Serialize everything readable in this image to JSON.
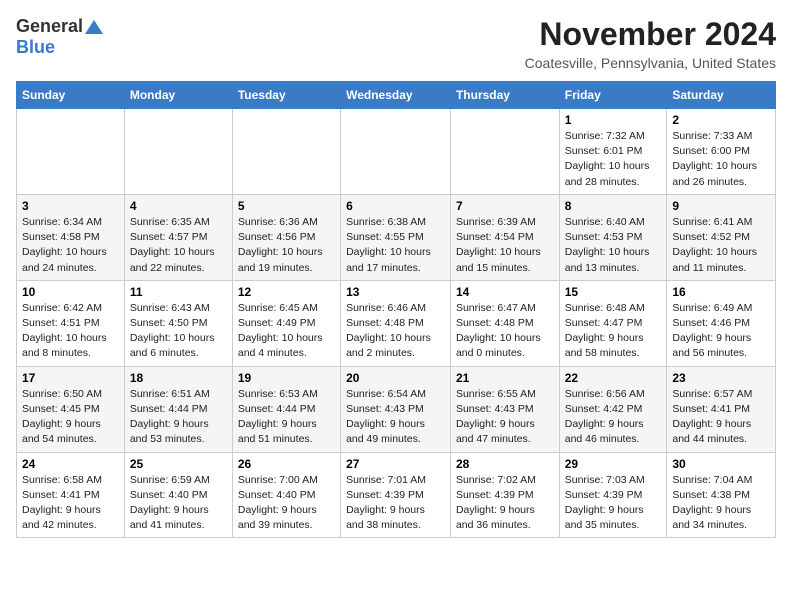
{
  "header": {
    "logo_general": "General",
    "logo_blue": "Blue",
    "month": "November 2024",
    "location": "Coatesville, Pennsylvania, United States"
  },
  "weekdays": [
    "Sunday",
    "Monday",
    "Tuesday",
    "Wednesday",
    "Thursday",
    "Friday",
    "Saturday"
  ],
  "weeks": [
    [
      {
        "day": "",
        "info": ""
      },
      {
        "day": "",
        "info": ""
      },
      {
        "day": "",
        "info": ""
      },
      {
        "day": "",
        "info": ""
      },
      {
        "day": "",
        "info": ""
      },
      {
        "day": "1",
        "info": "Sunrise: 7:32 AM\nSunset: 6:01 PM\nDaylight: 10 hours\nand 28 minutes."
      },
      {
        "day": "2",
        "info": "Sunrise: 7:33 AM\nSunset: 6:00 PM\nDaylight: 10 hours\nand 26 minutes."
      }
    ],
    [
      {
        "day": "3",
        "info": "Sunrise: 6:34 AM\nSunset: 4:58 PM\nDaylight: 10 hours\nand 24 minutes."
      },
      {
        "day": "4",
        "info": "Sunrise: 6:35 AM\nSunset: 4:57 PM\nDaylight: 10 hours\nand 22 minutes."
      },
      {
        "day": "5",
        "info": "Sunrise: 6:36 AM\nSunset: 4:56 PM\nDaylight: 10 hours\nand 19 minutes."
      },
      {
        "day": "6",
        "info": "Sunrise: 6:38 AM\nSunset: 4:55 PM\nDaylight: 10 hours\nand 17 minutes."
      },
      {
        "day": "7",
        "info": "Sunrise: 6:39 AM\nSunset: 4:54 PM\nDaylight: 10 hours\nand 15 minutes."
      },
      {
        "day": "8",
        "info": "Sunrise: 6:40 AM\nSunset: 4:53 PM\nDaylight: 10 hours\nand 13 minutes."
      },
      {
        "day": "9",
        "info": "Sunrise: 6:41 AM\nSunset: 4:52 PM\nDaylight: 10 hours\nand 11 minutes."
      }
    ],
    [
      {
        "day": "10",
        "info": "Sunrise: 6:42 AM\nSunset: 4:51 PM\nDaylight: 10 hours\nand 8 minutes."
      },
      {
        "day": "11",
        "info": "Sunrise: 6:43 AM\nSunset: 4:50 PM\nDaylight: 10 hours\nand 6 minutes."
      },
      {
        "day": "12",
        "info": "Sunrise: 6:45 AM\nSunset: 4:49 PM\nDaylight: 10 hours\nand 4 minutes."
      },
      {
        "day": "13",
        "info": "Sunrise: 6:46 AM\nSunset: 4:48 PM\nDaylight: 10 hours\nand 2 minutes."
      },
      {
        "day": "14",
        "info": "Sunrise: 6:47 AM\nSunset: 4:48 PM\nDaylight: 10 hours\nand 0 minutes."
      },
      {
        "day": "15",
        "info": "Sunrise: 6:48 AM\nSunset: 4:47 PM\nDaylight: 9 hours\nand 58 minutes."
      },
      {
        "day": "16",
        "info": "Sunrise: 6:49 AM\nSunset: 4:46 PM\nDaylight: 9 hours\nand 56 minutes."
      }
    ],
    [
      {
        "day": "17",
        "info": "Sunrise: 6:50 AM\nSunset: 4:45 PM\nDaylight: 9 hours\nand 54 minutes."
      },
      {
        "day": "18",
        "info": "Sunrise: 6:51 AM\nSunset: 4:44 PM\nDaylight: 9 hours\nand 53 minutes."
      },
      {
        "day": "19",
        "info": "Sunrise: 6:53 AM\nSunset: 4:44 PM\nDaylight: 9 hours\nand 51 minutes."
      },
      {
        "day": "20",
        "info": "Sunrise: 6:54 AM\nSunset: 4:43 PM\nDaylight: 9 hours\nand 49 minutes."
      },
      {
        "day": "21",
        "info": "Sunrise: 6:55 AM\nSunset: 4:43 PM\nDaylight: 9 hours\nand 47 minutes."
      },
      {
        "day": "22",
        "info": "Sunrise: 6:56 AM\nSunset: 4:42 PM\nDaylight: 9 hours\nand 46 minutes."
      },
      {
        "day": "23",
        "info": "Sunrise: 6:57 AM\nSunset: 4:41 PM\nDaylight: 9 hours\nand 44 minutes."
      }
    ],
    [
      {
        "day": "24",
        "info": "Sunrise: 6:58 AM\nSunset: 4:41 PM\nDaylight: 9 hours\nand 42 minutes."
      },
      {
        "day": "25",
        "info": "Sunrise: 6:59 AM\nSunset: 4:40 PM\nDaylight: 9 hours\nand 41 minutes."
      },
      {
        "day": "26",
        "info": "Sunrise: 7:00 AM\nSunset: 4:40 PM\nDaylight: 9 hours\nand 39 minutes."
      },
      {
        "day": "27",
        "info": "Sunrise: 7:01 AM\nSunset: 4:39 PM\nDaylight: 9 hours\nand 38 minutes."
      },
      {
        "day": "28",
        "info": "Sunrise: 7:02 AM\nSunset: 4:39 PM\nDaylight: 9 hours\nand 36 minutes."
      },
      {
        "day": "29",
        "info": "Sunrise: 7:03 AM\nSunset: 4:39 PM\nDaylight: 9 hours\nand 35 minutes."
      },
      {
        "day": "30",
        "info": "Sunrise: 7:04 AM\nSunset: 4:38 PM\nDaylight: 9 hours\nand 34 minutes."
      }
    ]
  ]
}
